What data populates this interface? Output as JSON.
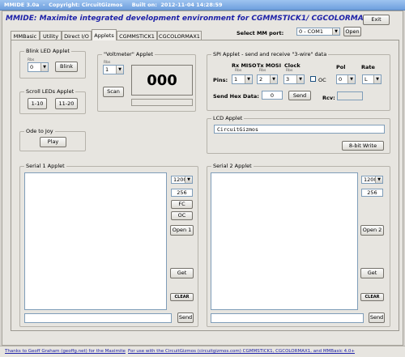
{
  "window": {
    "title": "MMIDE 3.0a  -  Copyright: CircuitGizmos     Built on:  2012-11-04 14:28:59"
  },
  "header": {
    "banner": "MMIDE: Maximite integrated development environment for CGMMSTICK1/ CGCOLORMAX1",
    "exit_label": "Exit",
    "port_label": "Select MM port:",
    "port_value": "0 - COM1",
    "open_label": "Open"
  },
  "tabs": [
    "MMBasic",
    "Utility",
    "Direct I/O",
    "Applets",
    "CGMMSTICK1",
    "CGCOLORMAX1"
  ],
  "blink": {
    "title": "Blink LED Applet",
    "sub": "Rbs",
    "value": "0",
    "button": "Blink"
  },
  "scroll": {
    "title": "Scroll LEDs Applet",
    "btn1": "1-10",
    "btn2": "11-20"
  },
  "ode": {
    "title": "Ode to Joy",
    "button": "Play"
  },
  "voltmeter": {
    "title": "\"Voltmeter\" Applet",
    "sub": "Rbs",
    "value": "1",
    "button": "Scan",
    "reading": "000"
  },
  "spi": {
    "title": "SPI Applet - send and receive \"3-wire\" data",
    "rx_label": "Rx MISO",
    "tx_label": "Tx MOSI",
    "clk_label": "Clock",
    "pol_label": "Pol",
    "rate_label": "Rate",
    "pins_label": "Pins:",
    "rx_sub": "Rbs",
    "tx_sub": "Rbs",
    "clk_sub": "Rbs",
    "rx_value": "1",
    "tx_value": "2",
    "clk_value": "3",
    "oc_label": "OC",
    "pol_value": "0",
    "rate_value": "L",
    "send_hex_label": "Send Hex Data:",
    "send_hex_value": "0",
    "send_label": "Send",
    "rcv_label": "Rcv:"
  },
  "lcd": {
    "title": "LCD Applet",
    "text": "CircuitGizmos",
    "button": "8-bit Write"
  },
  "serial1": {
    "title": "Serial 1 Applet",
    "baud": "1200",
    "buffer": "256",
    "fc": "FC",
    "oc": "OC",
    "open": "Open 1",
    "get": "Get",
    "clear": "CLEAR",
    "send": "Send"
  },
  "serial2": {
    "title": "Serial 2 Applet",
    "baud": "1200",
    "buffer": "256",
    "open": "Open 2",
    "get": "Get",
    "clear": "CLEAR",
    "send": "Send"
  },
  "footer": {
    "left": "Thanks to Geoff Graham (geoffg.net) for the Maximite",
    "right": "For use with the CircuitGizmos (circuitgizmos.com) CGMMSTICK1, CGCOLORMAX1,  and MMBasic 4.0+"
  }
}
